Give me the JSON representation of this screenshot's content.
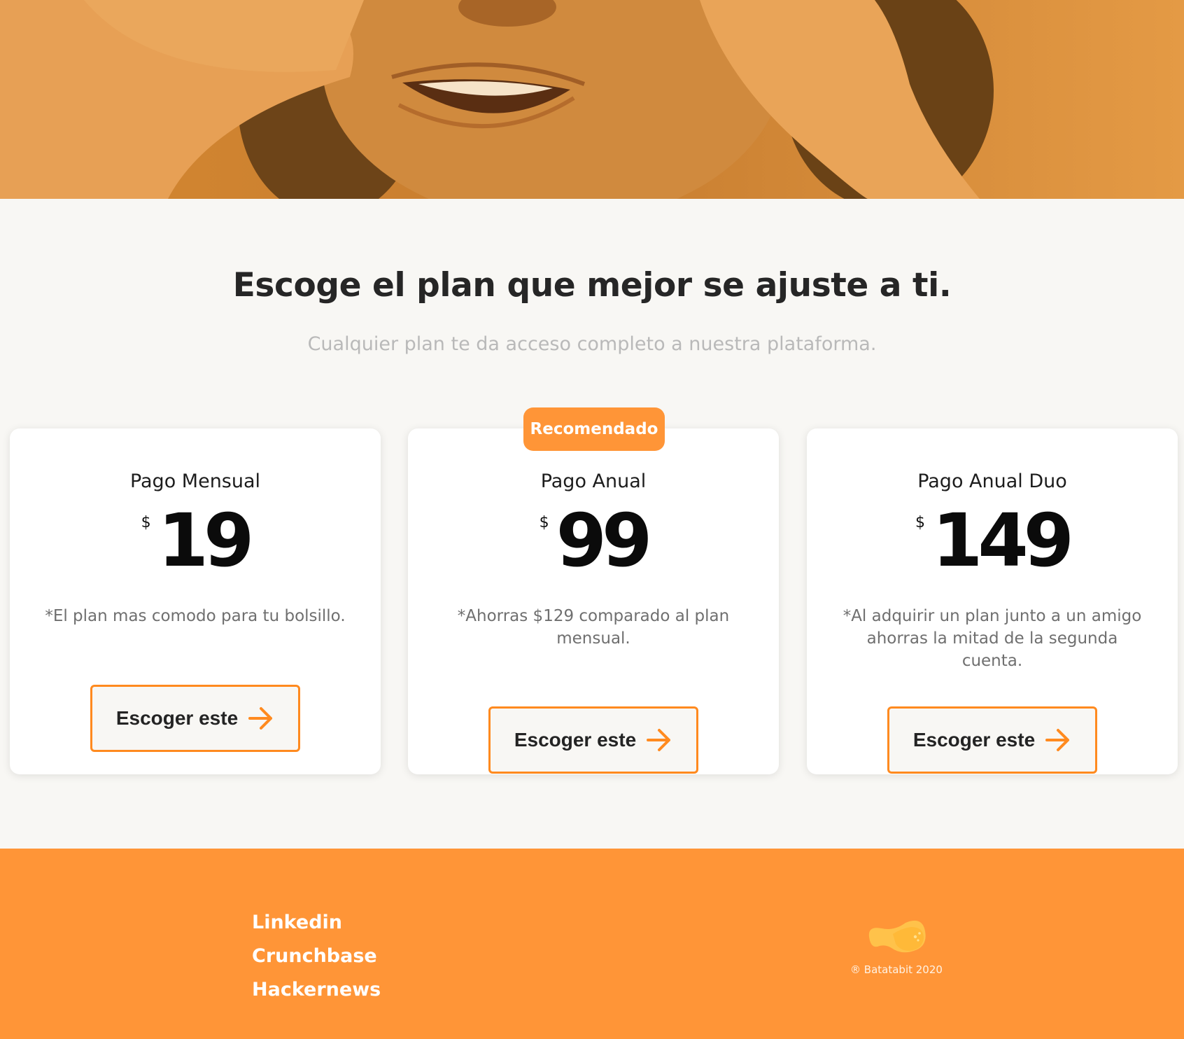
{
  "pricing": {
    "title": "Escoge el plan que mejor se ajuste a ti.",
    "subtitle": "Cualquier plan te da acceso completo a nuestra plataforma.",
    "badge": "Recomendado",
    "plans": [
      {
        "name": "Pago Mensual",
        "currency": "$",
        "price": "19",
        "description": "*El plan mas comodo para tu bolsillo.",
        "cta": "Escoger este"
      },
      {
        "name": "Pago Anual",
        "currency": "$",
        "price": "99",
        "description": "*Ahorras $129 comparado al plan mensual.",
        "cta": "Escoger este"
      },
      {
        "name": "Pago Anual Duo",
        "currency": "$",
        "price": "149",
        "description": "*Al adquirir un plan junto a un amigo ahorras la mitad de la segunda cuenta.",
        "cta": "Escoger este"
      }
    ]
  },
  "footer": {
    "links": [
      "Linkedin",
      "Crunchbase",
      "Hackernews"
    ],
    "copyright": "® Batatabit 2020"
  },
  "colors": {
    "accent": "#ff9537",
    "button_border": "#ff8a1f",
    "heading": "#262626",
    "subheading": "#b9b9b9"
  },
  "icons": {
    "button": "arrow-right-icon",
    "brand": "batatabit-logo"
  }
}
